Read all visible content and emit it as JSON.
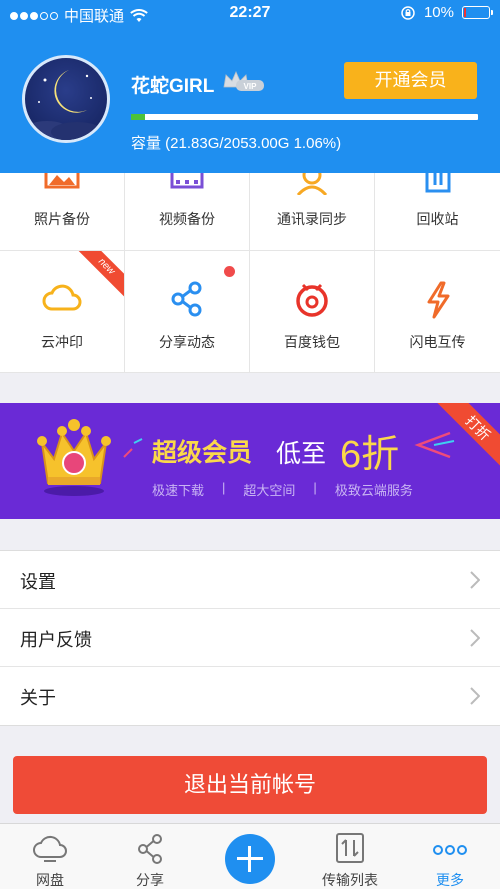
{
  "status_bar": {
    "carrier": "中国联通",
    "time": "22:27",
    "battery": "10%",
    "battery_level": 0.1
  },
  "profile": {
    "username": "花蛇GIRL",
    "vip_badge": "VIP",
    "open_vip_label": "开通会员",
    "storage_text": "容量 (21.83G/2053.00G 1.06%)",
    "storage_used_fraction": 0.0106
  },
  "grid": {
    "items": [
      {
        "label": "照片备份",
        "icon": "photo-icon",
        "color": "#f06b2a"
      },
      {
        "label": "视频备份",
        "icon": "video-icon",
        "color": "#7a4fd6"
      },
      {
        "label": "通讯录同步",
        "icon": "contacts-icon",
        "color": "#f7a823"
      },
      {
        "label": "回收站",
        "icon": "trash-icon",
        "color": "#2a8ff0"
      },
      {
        "label": "云冲印",
        "icon": "cloud-icon",
        "color": "#f7b21b",
        "badge": "new"
      },
      {
        "label": "分享动态",
        "icon": "share-icon",
        "color": "#2a8ff0",
        "dot": true
      },
      {
        "label": "百度钱包",
        "icon": "wallet-icon",
        "color": "#e8342a"
      },
      {
        "label": "闪电互传",
        "icon": "lightning-icon",
        "color": "#f06b2a"
      }
    ]
  },
  "banner": {
    "title": "超级会员",
    "subtitle_a": "低至",
    "discount": "6折",
    "ribbon": "打折",
    "features": [
      "极速下载",
      "|",
      "超大空间",
      "|",
      "极致云端服务"
    ]
  },
  "menu": {
    "items": [
      {
        "label": "设置"
      },
      {
        "label": "用户反馈"
      },
      {
        "label": "关于"
      }
    ]
  },
  "logout_label": "退出当前帐号",
  "tabbar": {
    "tabs": [
      {
        "label": "网盘"
      },
      {
        "label": "分享"
      },
      {
        "label": "传输列表"
      },
      {
        "label": "更多"
      }
    ]
  }
}
